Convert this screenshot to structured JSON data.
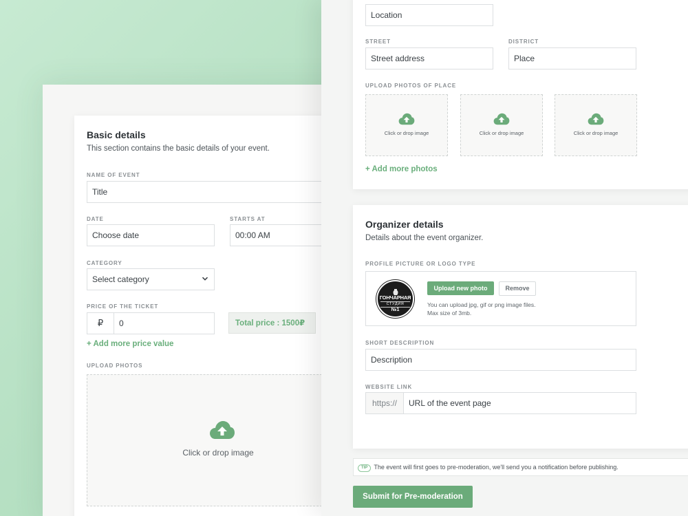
{
  "colors": {
    "accent": "#6bab7a",
    "background": "#b6e0c3"
  },
  "basic": {
    "title": "Basic details",
    "subtitle": "This section contains the basic details of your event.",
    "name_label": "Name of event",
    "name_placeholder": "Title",
    "date_label": "Date",
    "date_placeholder": "Choose date",
    "starts_label": "Starts at",
    "starts_value": "00:00 AM",
    "category_label": "Category",
    "category_value": "Select category",
    "price_label": "Price of the ticket",
    "currency_symbol": "₽",
    "price_value": "0",
    "total_price": "Total price : 1500₽",
    "add_price_link": "+ Add more price value",
    "upload_label": "Upload photos",
    "upload_text": "Click or drop image"
  },
  "location": {
    "location_placeholder": "Location",
    "street_label": "Street",
    "street_placeholder": "Street address",
    "district_label": "District",
    "district_placeholder": "Place",
    "photos_label": "Upload photos of place",
    "drop_texts": [
      "Click or drop image",
      "Click or drop image",
      "Click or drop image"
    ],
    "add_photos_link": "+ Add more photos"
  },
  "organizer": {
    "title": "Organizer details",
    "subtitle": "Details about the event organizer.",
    "profile_label": "Profile picture or logo type",
    "logo_text_top": "ГОНЧАРНАЯ",
    "logo_text_mid": "СТУДИЯ",
    "logo_text_bot": "№1",
    "upload_button": "Upload new photo",
    "remove_button": "Remove",
    "upload_hint_1": "You can upload jpg, gif or png image files.",
    "upload_hint_2": "Max size of 3mb.",
    "short_desc_label": "Short description",
    "short_desc_placeholder": "Description",
    "website_label": "Website link",
    "website_prefix": "https://",
    "website_placeholder": "URL of the event page"
  },
  "tip": {
    "badge": "TIP",
    "text": "The event will first goes to pre-moderation, we'll send you a notification before publishing."
  },
  "submit_button": "Submit for Pre-moderation",
  "icons": {
    "upload": "cloud-upload-icon",
    "chevron": "chevron-down-icon"
  }
}
